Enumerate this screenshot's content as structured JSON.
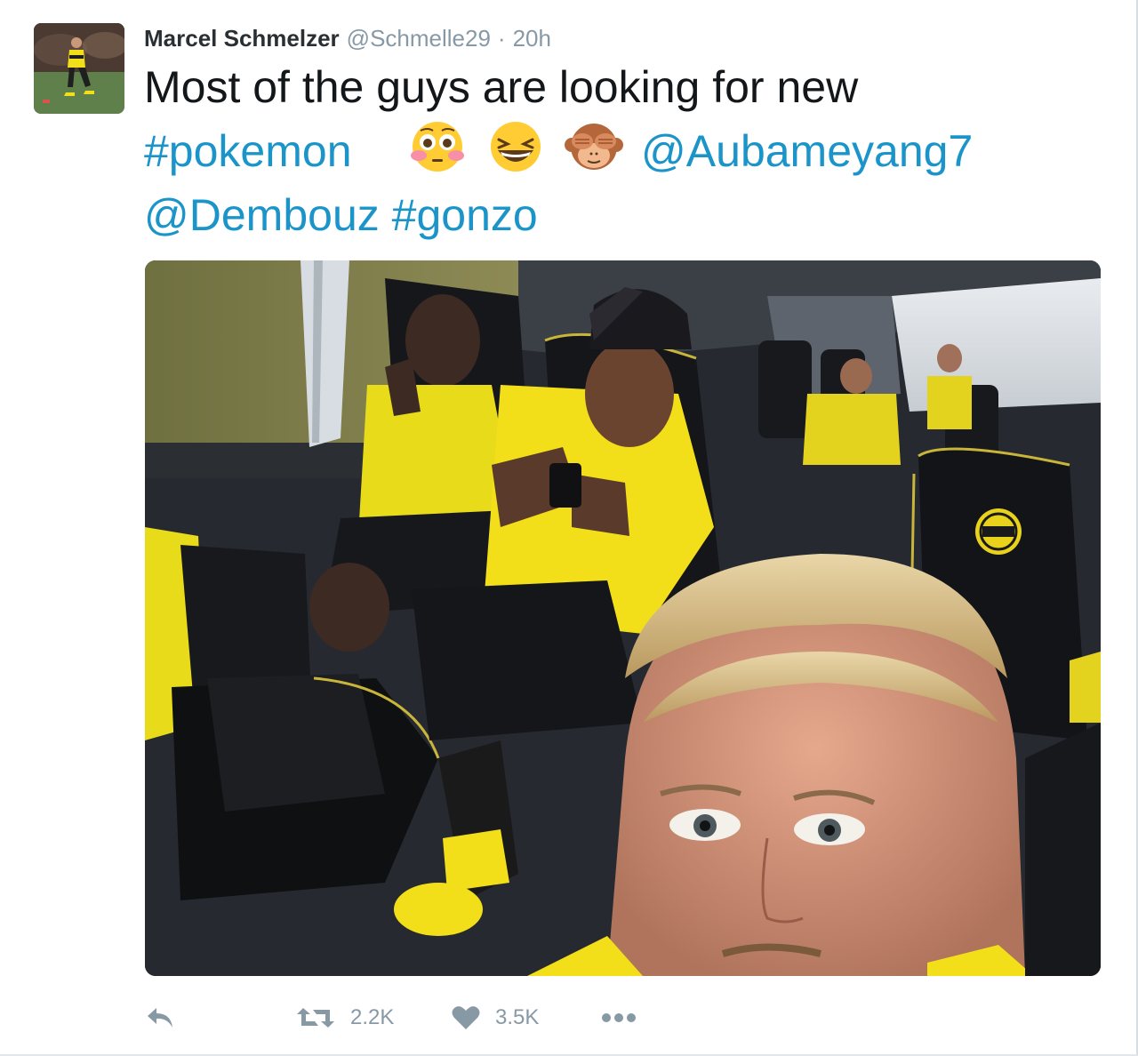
{
  "tweet": {
    "author_name": "Marcel Schmelzer",
    "handle": "@Schmelle29",
    "separator": "·",
    "time": "20h",
    "text_line1": "Most of the guys are looking for new",
    "hashtag_pokemon": "#pokemon",
    "mention_aubameyang": "@Aubameyang7",
    "mention_dembouz": "@Dembouz",
    "hashtag_gonzo": "#gonzo",
    "emojis": [
      "flushed-face-emoji",
      "grinning-squinting-face-emoji",
      "see-no-evil-monkey-emoji"
    ]
  },
  "actions": {
    "reply_icon": "reply-icon",
    "retweet_icon": "retweet-icon",
    "retweet_count": "2.2K",
    "like_icon": "heart-icon",
    "like_count": "3.5K",
    "more_icon": "more-icon"
  },
  "colors": {
    "link": "#1b95c9",
    "muted": "#8899a6",
    "text": "#14171a",
    "jersey_yellow": "#f2df1a"
  }
}
